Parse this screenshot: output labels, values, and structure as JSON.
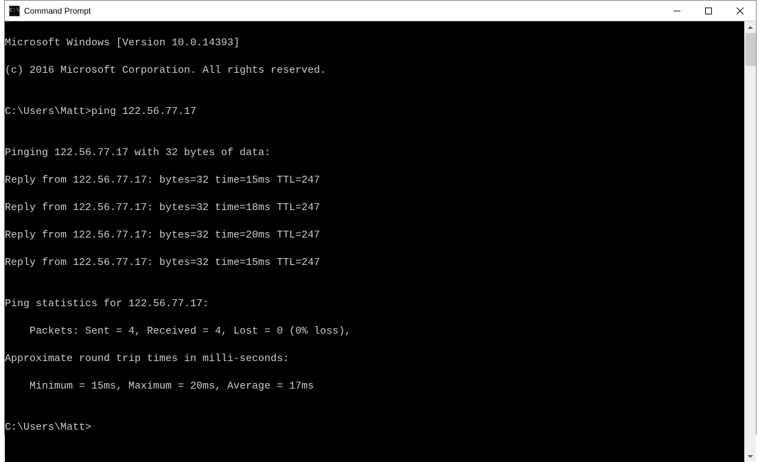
{
  "window": {
    "title": "Command Prompt",
    "icon_label": "C:\\"
  },
  "terminal": {
    "lines": {
      "l0": "Microsoft Windows [Version 10.0.14393]",
      "l1": "(c) 2016 Microsoft Corporation. All rights reserved.",
      "l2": "",
      "l3": "C:\\Users\\Matt>ping 122.56.77.17",
      "l4": "",
      "l5": "Pinging 122.56.77.17 with 32 bytes of data:",
      "l6": "Reply from 122.56.77.17: bytes=32 time=15ms TTL=247",
      "l7": "Reply from 122.56.77.17: bytes=32 time=18ms TTL=247",
      "l8": "Reply from 122.56.77.17: bytes=32 time=20ms TTL=247",
      "l9": "Reply from 122.56.77.17: bytes=32 time=15ms TTL=247",
      "l10": "",
      "l11": "Ping statistics for 122.56.77.17:",
      "l12": "    Packets: Sent = 4, Received = 4, Lost = 0 (0% loss),",
      "l13": "Approximate round trip times in milli-seconds:",
      "l14": "    Minimum = 15ms, Maximum = 20ms, Average = 17ms",
      "l15": "",
      "l16": "C:\\Users\\Matt>"
    }
  }
}
